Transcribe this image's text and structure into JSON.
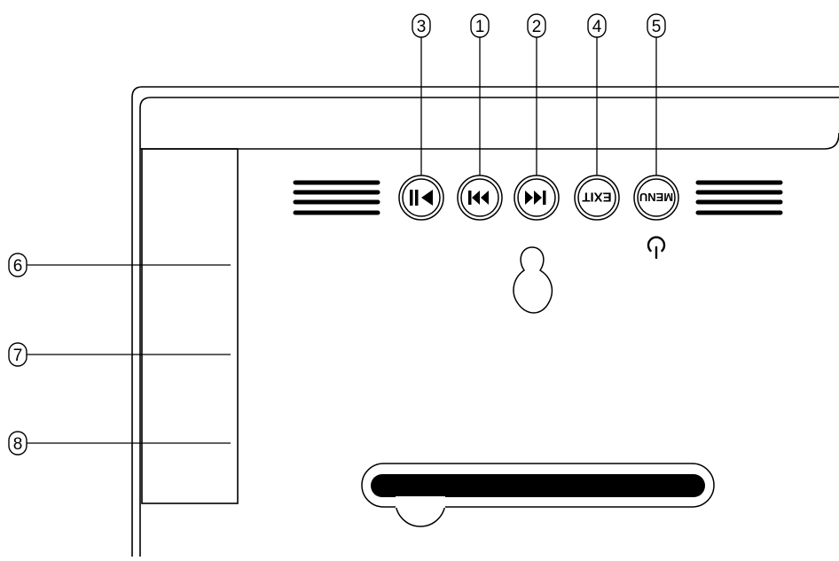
{
  "callouts": {
    "pause_play": "3",
    "previous": "1",
    "next": "2",
    "exit": "4",
    "menu": "5",
    "port_top": "6",
    "port_middle": "7",
    "port_bottom": "8"
  },
  "buttons": {
    "exit_label": "EXIT",
    "menu_label": "MENU"
  },
  "icons": {
    "pause_play": "pause-play-icon",
    "previous": "skip-previous-icon",
    "next": "skip-next-icon",
    "power": "power-icon",
    "wall_mount": "keyhole-mount-icon"
  },
  "colors": {
    "line": "#000000",
    "background": "#ffffff"
  }
}
